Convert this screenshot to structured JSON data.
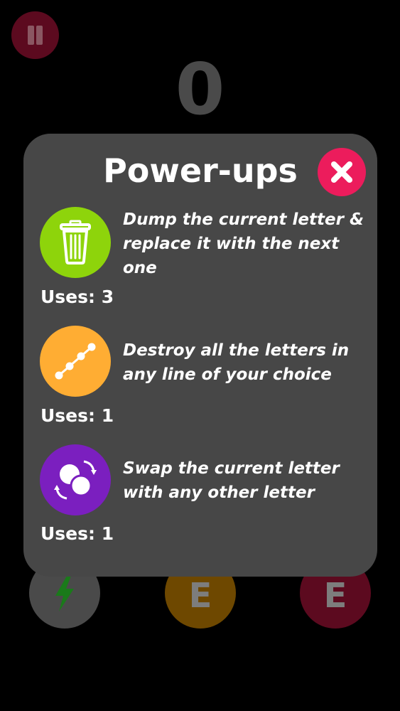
{
  "hud": {
    "pause_icon": "pause-icon",
    "score": "0"
  },
  "board": {
    "tiles": [
      {
        "name": "bolt-tile",
        "icon": "lightning-bolt-icon",
        "letter": "",
        "color": "#4a4a4a"
      },
      {
        "name": "letter-tile-e-orange",
        "letter": "E",
        "color": "#6e4800"
      },
      {
        "name": "letter-tile-e-red",
        "letter": "E",
        "color": "#5c0a1f"
      }
    ]
  },
  "powerups_dialog": {
    "title": "Power-ups",
    "close_icon": "close-icon",
    "items": [
      {
        "icon": "trash-can-icon",
        "color": "#8ed40b",
        "description": "Dump the current letter & replace it with the next one",
        "uses": "Uses: 3"
      },
      {
        "icon": "line-of-dots-icon",
        "color": "#ffad33",
        "description": "Destroy all the letters in any line of your choice",
        "uses": "Uses: 1"
      },
      {
        "icon": "swap-circles-icon",
        "color": "#7b1fbf",
        "description": "Swap the current letter with any other letter",
        "uses": "Uses: 1"
      }
    ]
  },
  "colors": {
    "background": "#000000",
    "panel": "#474747",
    "close_button": "#ec1c5c",
    "text": "#ffffff",
    "score_text": "#4a4a4a"
  }
}
